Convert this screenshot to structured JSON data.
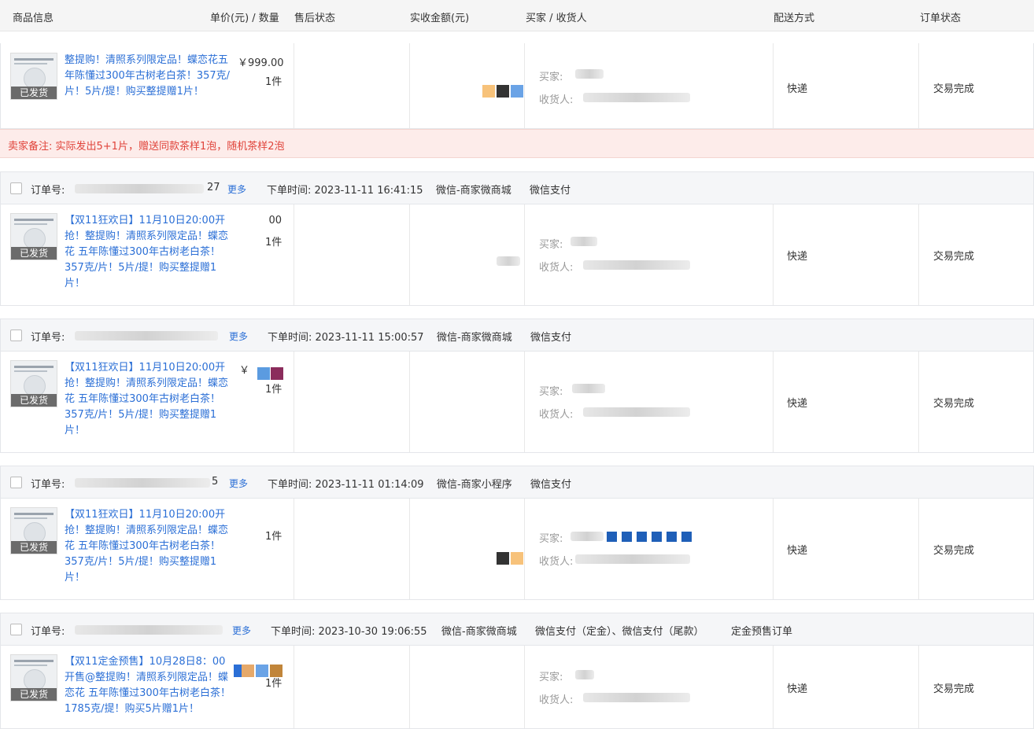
{
  "header": {
    "product": "商品信息",
    "price_qty": "单价(元) / 数量",
    "after_sale": "售后状态",
    "amount": "实收金额(元)",
    "buyer": "买家 / 收货人",
    "delivery": "配送方式",
    "status": "订单状态"
  },
  "labels": {
    "order_no": "订单号:",
    "more": "更多",
    "buyer": "买家:",
    "receiver": "收货人:"
  },
  "remark": "卖家备注:  实际发出5+1片，赠送同款茶样1泡，随机茶样2泡",
  "orders": [
    {
      "order_tail": "",
      "order_time": "",
      "channel": "",
      "payment": "",
      "tag": "",
      "title": "整提购！清照系列限定品！蝶恋花五年陈懂过300年古树老白茶！357克/片！5片/提！购买整提赠1片！",
      "badge": "已发货",
      "price": "￥999.00",
      "qty": "1件",
      "delivery": "快递",
      "status": "交易完成"
    },
    {
      "order_tail": "27",
      "order_time": "下单时间:  2023-11-11 16:41:15",
      "channel": "微信-商家微商城",
      "payment": "微信支付",
      "tag": "",
      "title": "【双11狂欢日】11月10日20:00开抢！整提购！清照系列限定品！蝶恋花 五年陈懂过300年古树老白茶！357克/片！5片/提！购买整提赠1片！",
      "badge": "已发货",
      "price": "00",
      "qty": "1件",
      "delivery": "快递",
      "status": "交易完成"
    },
    {
      "order_tail": "",
      "order_time": "下单时间:  2023-11-11 15:00:57",
      "channel": "微信-商家微商城",
      "payment": "微信支付",
      "tag": "",
      "title": "【双11狂欢日】11月10日20:00开抢！整提购！清照系列限定品！蝶恋花 五年陈懂过300年古树老白茶！357克/片！5片/提！购买整提赠1片！",
      "badge": "已发货",
      "price": "￥",
      "qty": "1件",
      "delivery": "快递",
      "status": "交易完成"
    },
    {
      "order_tail": "5",
      "order_time": "下单时间:  2023-11-11 01:14:09",
      "channel": "微信-商家小程序",
      "payment": "微信支付",
      "tag": "",
      "title": "【双11狂欢日】11月10日20:00开抢！整提购！清照系列限定品！蝶恋花 五年陈懂过300年古树老白茶！357克/片！5片/提！购买整提赠1片！",
      "badge": "已发货",
      "price": "",
      "qty": "1件",
      "delivery": "快递",
      "status": "交易完成"
    },
    {
      "order_tail": "",
      "order_time": "下单时间:  2023-10-30 19:06:55",
      "channel": "微信-商家微商城",
      "payment": "微信支付（定金）、微信支付（尾款）",
      "tag": "定金预售订单",
      "title": "【双11定金预售】10月28日8：00开售@整提购！清照系列限定品！蝶恋花 五年陈懂过300年古树老白茶！1785克/提！购买5片赠1片！",
      "badge": "已发货",
      "price": "",
      "qty": "1件",
      "delivery": "快递",
      "status": "交易完成"
    }
  ]
}
